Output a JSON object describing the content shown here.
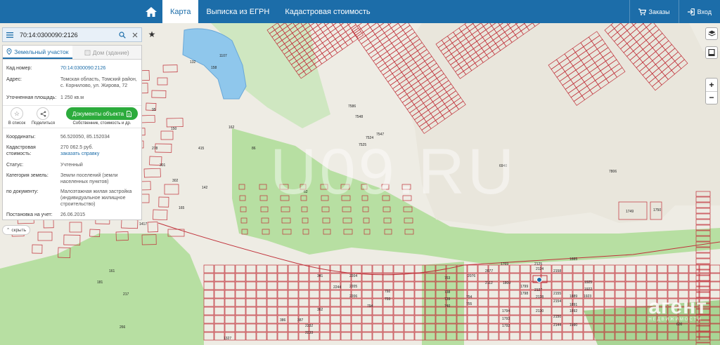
{
  "topbar": {
    "tabs": [
      {
        "label": "Карта",
        "active": true
      },
      {
        "label": "Выписка из ЕГРН",
        "active": false
      },
      {
        "label": "Кадастровая стоимость",
        "active": false
      }
    ],
    "orders_label": "Заказы",
    "login_label": "Вход",
    "bar_color": "#1c6da9"
  },
  "search": {
    "value": "70:14:0300090:2126",
    "search_icon": "search-icon",
    "clear_icon": "close-icon"
  },
  "panel": {
    "tab_land": "Земельный участок",
    "tab_house": "Дом (здание)",
    "fields": {
      "cad_label": "Кад.номер:",
      "cad_value": "70:14:0300090:2126",
      "address_label": "Адрес:",
      "address_value": "Томская область, Томский район, с. Корнилово, ул. Жирова, 72",
      "area_label": "Уточненная площадь:",
      "area_value": "1 250 кв.м",
      "coords_label": "Координаты:",
      "coords_value": "56.520050, 85.152034",
      "cost_label": "Кадастровая стоимость:",
      "cost_value": "270 062.5 руб.",
      "cost_link": "заказать справку",
      "status_label": "Статус:",
      "status_value": "Учтенный",
      "category_label": "Категория земель:",
      "category_value": "Земли поселений (земли населенных пунктов)",
      "usage_label": "по документу:",
      "usage_value": "Малоэтажная жилая застройка (индивидуальное жилищное строительство)",
      "registered_label": "Постановка на учет:",
      "registered_value": "26.06.2015"
    },
    "actions": {
      "favorite_label": "В список",
      "share_label": "Поделиться",
      "docs_button": "Документы объекта",
      "docs_sub": "Собственник, стоимость и др."
    },
    "collapse_label": "скрыть",
    "docs_color": "#2cab3c"
  },
  "map": {
    "watermark": "U09.RU",
    "brand_big": "агент",
    "brand_small": "НЕДВИЖИМОСТИ",
    "green_color": "#b7dfa2",
    "line_color": "#c0313a",
    "labels": [
      {
        "t": "1107"
      },
      {
        "t": "1749"
      },
      {
        "t": "1750"
      },
      {
        "t": "1417"
      },
      {
        "t": "142"
      },
      {
        "t": "62"
      },
      {
        "t": "95"
      },
      {
        "t": "165"
      },
      {
        "t": "2204"
      },
      {
        "t": "2205"
      },
      {
        "t": "2206"
      },
      {
        "t": "2112"
      },
      {
        "t": "1800"
      },
      {
        "t": "2125"
      },
      {
        "t": "2127"
      },
      {
        "t": "1799"
      },
      {
        "t": "1798"
      },
      {
        "t": "2150"
      },
      {
        "t": "2154"
      },
      {
        "t": "1923"
      },
      {
        "t": "1889"
      },
      {
        "t": "600"
      },
      {
        "t": "1327"
      },
      {
        "t": "763"
      },
      {
        "t": "2076"
      },
      {
        "t": "2077"
      },
      {
        "t": "1769"
      },
      {
        "t": "2124"
      },
      {
        "t": "1885"
      },
      {
        "t": "1925"
      },
      {
        "t": "2158"
      },
      {
        "t": "1922"
      },
      {
        "t": "2155"
      },
      {
        "t": "2128"
      },
      {
        "t": "1891"
      },
      {
        "t": "1892"
      },
      {
        "t": "1990"
      },
      {
        "t": "2130"
      },
      {
        "t": "1794"
      },
      {
        "t": "1793"
      },
      {
        "t": "1792"
      },
      {
        "t": "2144"
      },
      {
        "t": "7806"
      },
      {
        "t": "6940"
      },
      {
        "t": "7524"
      },
      {
        "t": "7525"
      },
      {
        "t": "7548"
      },
      {
        "t": "7586"
      },
      {
        "t": "7547"
      },
      {
        "t": "2232"
      },
      {
        "t": "2233"
      },
      {
        "t": "2244"
      },
      {
        "t": "794"
      },
      {
        "t": "793"
      },
      {
        "t": "792"
      },
      {
        "t": "738"
      },
      {
        "t": "739"
      },
      {
        "t": "740"
      },
      {
        "t": "754"
      },
      {
        "t": "755"
      },
      {
        "t": "341"
      },
      {
        "t": "362"
      },
      {
        "t": "386"
      },
      {
        "t": "387"
      },
      {
        "t": "266"
      },
      {
        "t": "217"
      },
      {
        "t": "181"
      },
      {
        "t": "161"
      },
      {
        "t": "278"
      },
      {
        "t": "301"
      },
      {
        "t": "302"
      },
      {
        "t": "415"
      },
      {
        "t": "150"
      },
      {
        "t": "132"
      },
      {
        "t": "158"
      },
      {
        "t": "162"
      },
      {
        "t": "86"
      }
    ]
  }
}
